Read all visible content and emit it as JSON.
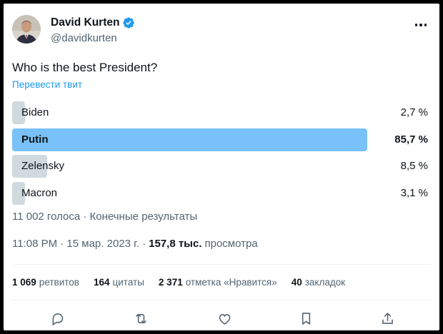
{
  "author": {
    "display_name": "David Kurten",
    "handle": "@davidkurten",
    "verified": true,
    "verified_color": "#1d9bf0"
  },
  "tweet": {
    "text": "Who is the best President?",
    "translate_link": "Перевести твит"
  },
  "poll": {
    "options": [
      {
        "label": "Biden",
        "percent_text": "2,7 %",
        "percent": 2.7,
        "winner": false
      },
      {
        "label": "Putin",
        "percent_text": "85,7 %",
        "percent": 85.7,
        "winner": true
      },
      {
        "label": "Zelensky",
        "percent_text": "8,5 %",
        "percent": 8.5,
        "winner": false
      },
      {
        "label": "Macron",
        "percent_text": "3,1 %",
        "percent": 3.1,
        "winner": false
      }
    ],
    "meta": "11 002 голоса · Конечные результаты",
    "bar_color": "#cfd9de",
    "winner_bar_color": "#78c1f9"
  },
  "timestamp": {
    "text": "11:08 PM · 15 мар. 2023 г. ·",
    "views_count": "157,8 тыс.",
    "views_label": "просмотра"
  },
  "stats": [
    {
      "num": "1 069",
      "label": "ретвитов"
    },
    {
      "num": "164",
      "label": "цитаты"
    },
    {
      "num": "2 371",
      "label": "отметка «Нравится»"
    },
    {
      "num": "40",
      "label": "закладок"
    }
  ],
  "actions": [
    {
      "icon": "reply-icon"
    },
    {
      "icon": "retweet-icon"
    },
    {
      "icon": "like-icon"
    },
    {
      "icon": "bookmark-icon"
    },
    {
      "icon": "share-icon"
    }
  ]
}
